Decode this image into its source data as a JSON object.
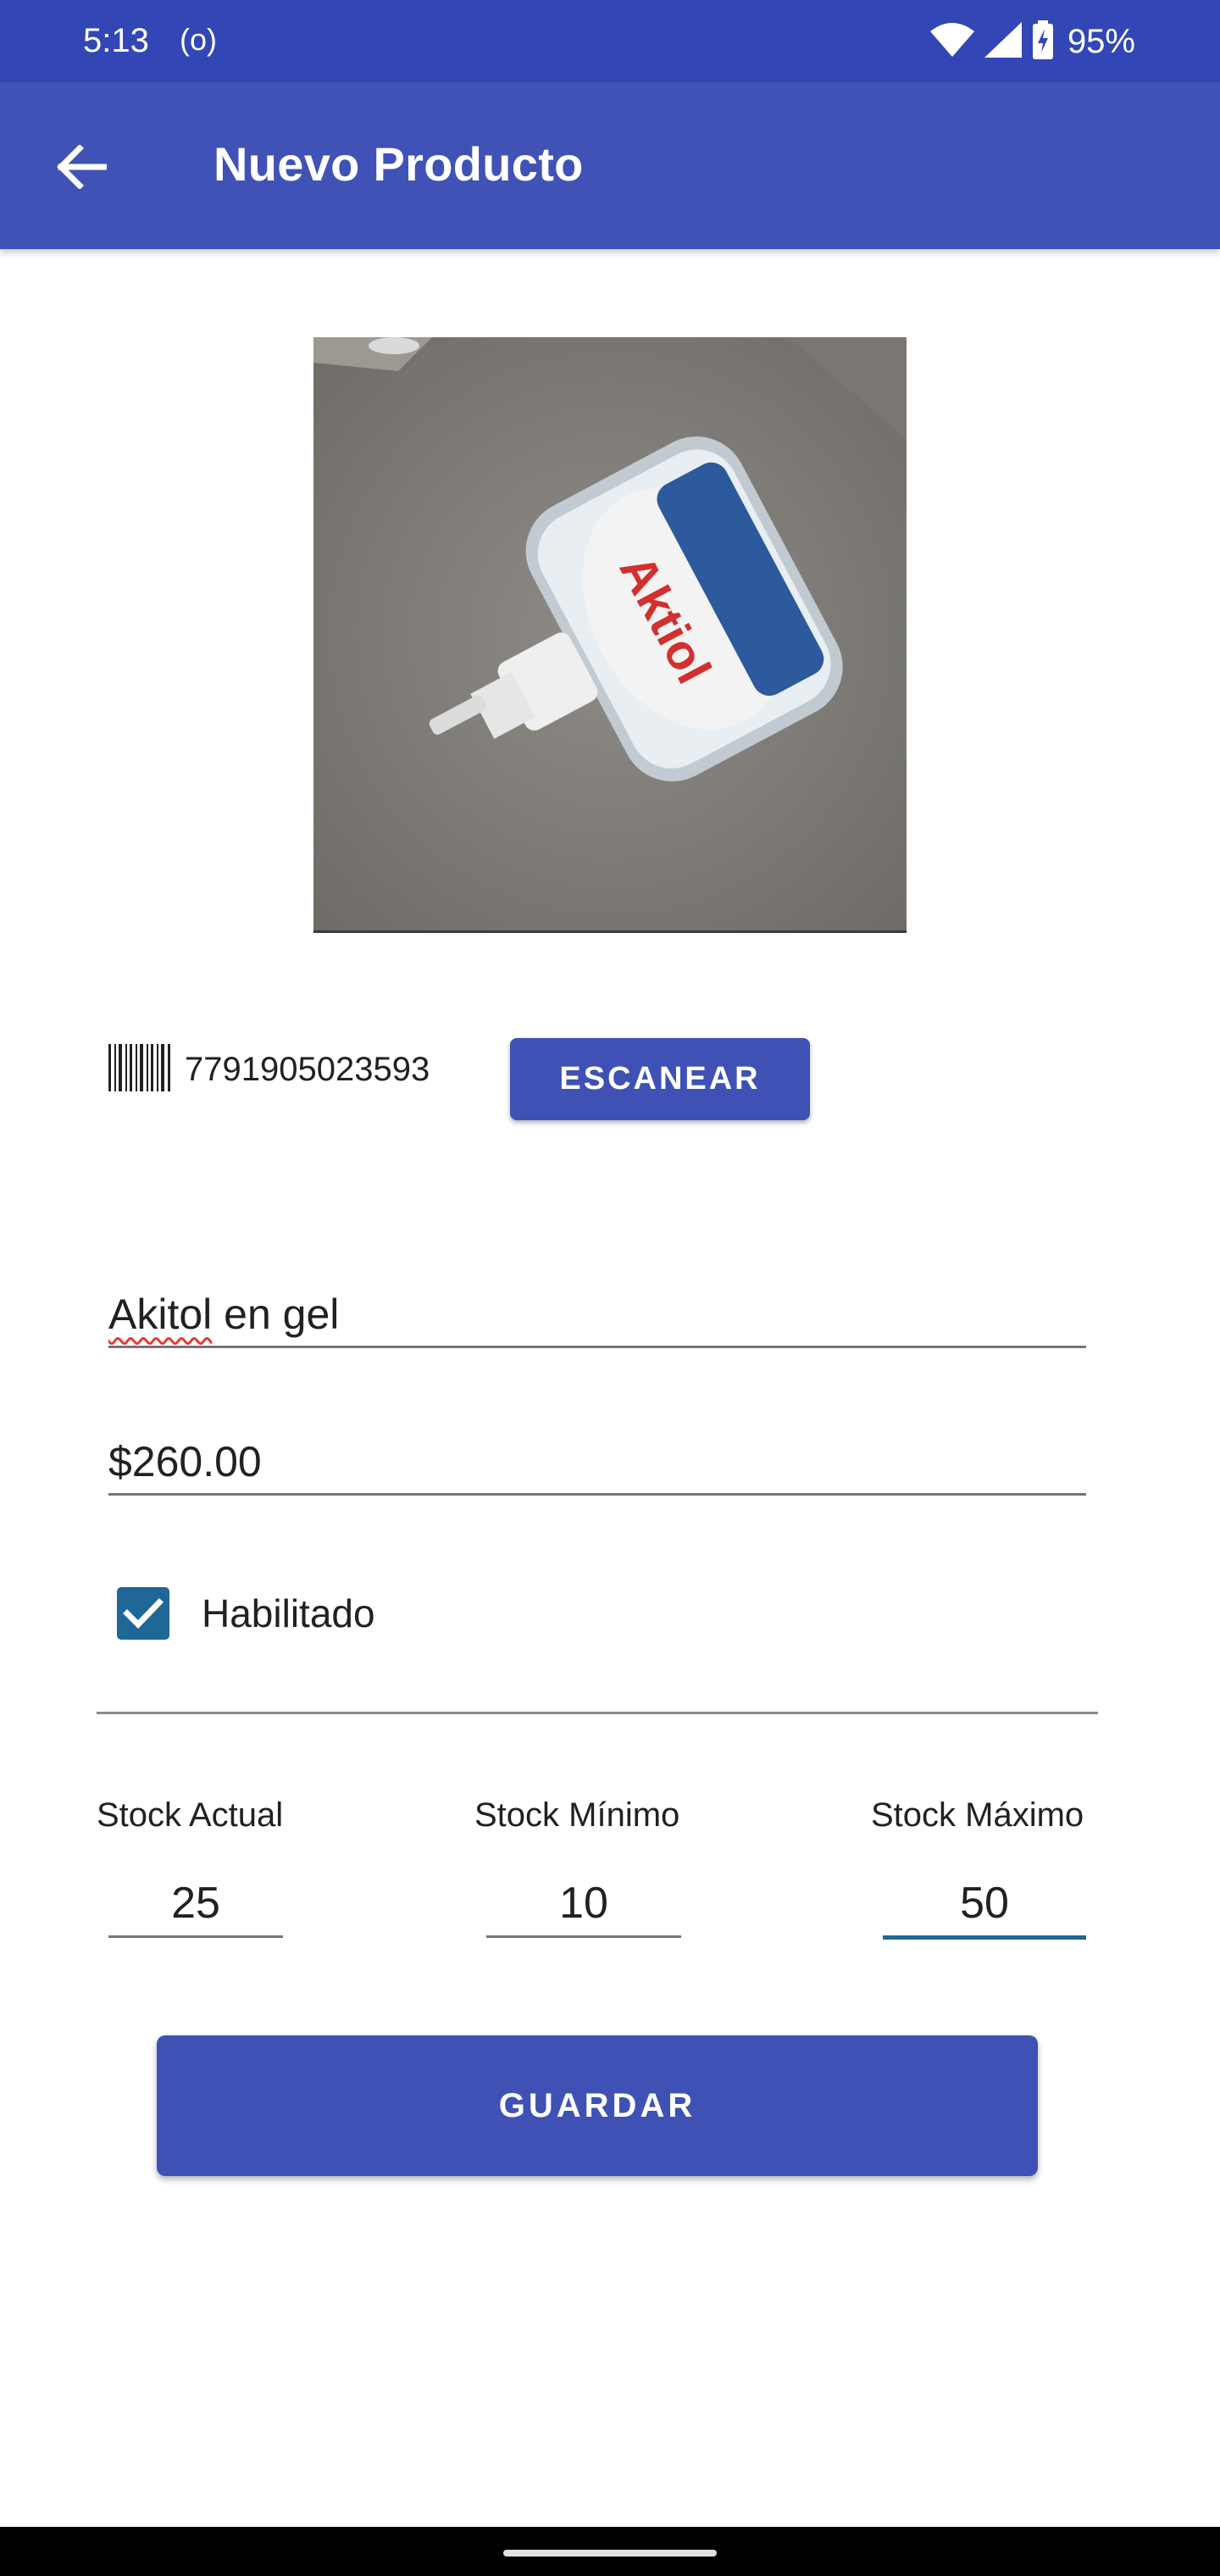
{
  "status_bar": {
    "time": "5:13",
    "cast_indicator": "(o)",
    "battery_percent": "95%",
    "icons": [
      "wifi-icon",
      "cell-signal-icon",
      "battery-charging-icon"
    ]
  },
  "app_bar": {
    "title": "Nuevo Producto",
    "back_icon": "arrow-back-icon"
  },
  "product": {
    "image_alt": "Akitol alcohol en gel",
    "barcode_icon": "barcode-icon",
    "barcode": "7791905023593",
    "scan_label": "ESCANEAR",
    "name_misspelled": "Akitol",
    "name_rest": " en gel",
    "price": "$260.00",
    "enabled_label": "Habilitado",
    "enabled": true
  },
  "stock": {
    "current_label": "Stock Actual",
    "current_value": "25",
    "min_label": "Stock Mínimo",
    "min_value": "10",
    "max_label": "Stock Máximo",
    "max_value": "50"
  },
  "actions": {
    "save_label": "GUARDAR"
  },
  "colors": {
    "primary": "#3f51b5",
    "status_bar": "#3346b5",
    "accent": "#1e6796"
  }
}
